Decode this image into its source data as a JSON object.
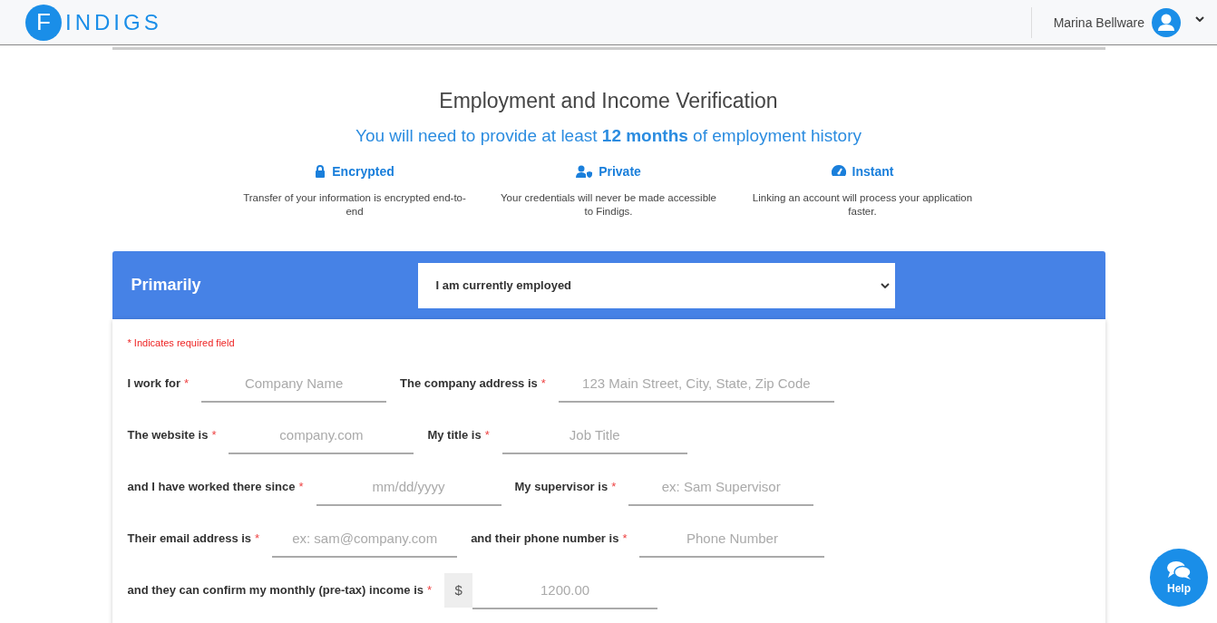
{
  "header": {
    "logo_initial": "F",
    "logo_text": "INDIGS",
    "user_name": "Marina Bellware"
  },
  "title": "Employment and Income Verification",
  "subtitle": "You will need to provide at least **12 months** of employment history",
  "features": [
    {
      "kind": "lock",
      "title": "Encrypted",
      "text": "Transfer of your information is encrypted end-to-end"
    },
    {
      "kind": "user-shield",
      "title": "Private",
      "text": "Your credentials will never be made accessible to Findigs."
    },
    {
      "kind": "gauge",
      "title": "Instant",
      "text": "Linking an account will process your application faster."
    }
  ],
  "card": {
    "title": "Primarily",
    "select_value": "I am currently employed",
    "required_note": "* Indicates required field"
  },
  "rows": [
    [
      {
        "label": "I work for",
        "marker": "*",
        "placeholder": "Company Name"
      },
      {
        "label": "The company address is",
        "marker": "*",
        "placeholder": "123 Main Street, City, State, Zip Code"
      }
    ],
    [
      {
        "label": "The website is",
        "marker": "*",
        "placeholder": "company.com"
      },
      {
        "label": "My title is",
        "marker": "*",
        "placeholder": "Job Title"
      }
    ],
    [
      {
        "label": "and I have worked there since",
        "marker": "*",
        "placeholder": "mm/dd/yyyy"
      },
      {
        "label": "My supervisor is",
        "marker": "*",
        "placeholder": "ex: Sam Supervisor"
      }
    ],
    [
      {
        "label": "Their email address is",
        "marker": "*",
        "placeholder": "ex: sam@company.com"
      },
      {
        "label": "and their phone number is",
        "marker": "*",
        "placeholder": "Phone Number"
      }
    ],
    [
      {
        "label": "and they can confirm my monthly (pre-tax) income is",
        "marker": "*",
        "prefix": "$",
        "placeholder": "1200.00"
      }
    ]
  ],
  "help": "Help"
}
